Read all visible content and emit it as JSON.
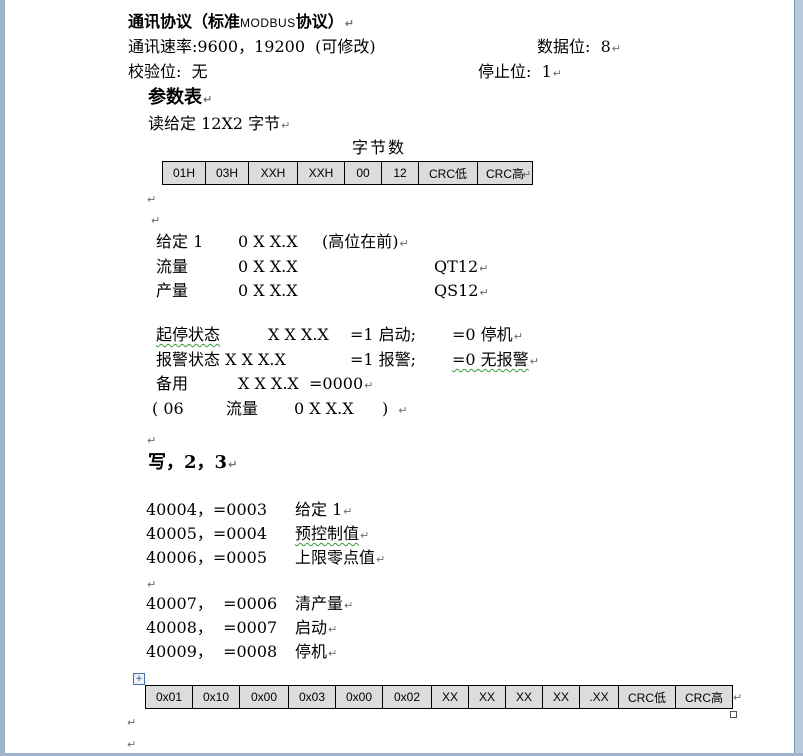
{
  "title": {
    "main": "通讯协议（标准",
    "modbus": "MODBUS",
    "tail": "协议）"
  },
  "comm": {
    "rate": "通讯速率:9600，19200  (可修改)",
    "databits": "数据位:  8",
    "parity": "校验位:  无",
    "stopbits": "停止位:  1"
  },
  "params": {
    "heading": "参数表",
    "read": "读给定 12X2 字节",
    "bytecount": "字节数",
    "frame1": [
      "01H",
      "03H",
      "XXH",
      "XXH",
      "00",
      "12",
      "CRC低",
      "CRC高"
    ],
    "setpoint": {
      "label": "给定 1",
      "value": "0 X X.X",
      "note": "(高位在前)"
    },
    "flow": {
      "label": "流量",
      "value": "0 X X.X",
      "code": "QT12"
    },
    "output": {
      "label": "产量",
      "value": "0 X X.X",
      "code": "QS12"
    },
    "startstop": {
      "label": "起停状态",
      "value": "X X X.X",
      "eq1": "=1 启动;",
      "eq0": "=0 停机"
    },
    "alarm": {
      "label": "报警状态 X X X.X",
      "eq1": "=1 报警;",
      "eq0": "=0 无报警"
    },
    "spare": {
      "label": "备用",
      "value": "X X X.X  =0000"
    },
    "flow06": {
      "open": "( 06",
      "label": "流量",
      "value": "0 X X.X",
      "close": ")"
    }
  },
  "write": {
    "heading": "写，2，3",
    "rows": [
      {
        "addr": "40004，=0003",
        "desc": "给定 1"
      },
      {
        "addr": "40005，=0004",
        "desc": "预控制值"
      },
      {
        "addr": "40006，=0005",
        "desc": "上限零点值"
      },
      {
        "addr": "40007，  =0006",
        "desc": "清产量"
      },
      {
        "addr": "40008，  =0007",
        "desc": "启动"
      },
      {
        "addr": "40009，  =0008",
        "desc": "停机"
      }
    ],
    "frame2": [
      "0x01",
      "0x10",
      "0x00",
      "0x03",
      "0x00",
      "0x02",
      "XX",
      "XX",
      "XX",
      "XX",
      ".XX",
      "CRC低",
      "CRC高"
    ]
  },
  "marks": {
    "paragraph": "↵",
    "anchor": "+"
  },
  "colors": {
    "frame": "#9fb3cf",
    "cell": "#dcdcdc",
    "spellcheck": "#3a9a3a"
  }
}
